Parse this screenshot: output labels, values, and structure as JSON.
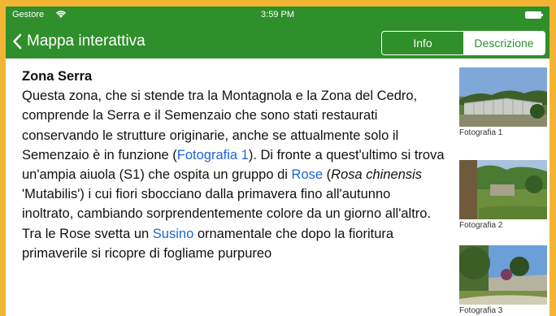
{
  "status_bar": {
    "carrier": "Gestore",
    "time": "3:59 PM",
    "wifi_icon": "wifi-icon",
    "battery_icon": "battery-icon"
  },
  "nav": {
    "back_label": "Mappa interattiva",
    "back_icon": "chevron-left-icon",
    "tabs": [
      {
        "label": "Info",
        "selected": false
      },
      {
        "label": "Descrizione",
        "selected": true
      }
    ]
  },
  "colors": {
    "bar_green": "#2f8f2b",
    "link_blue": "#1a66d6",
    "border_orange": "#f2b533"
  },
  "article": {
    "title": "Zona Serra",
    "p1": "Questa zona, che si stende tra la Montagnola e la Zona del Cedro, comprende la Serra e il Semenzaio che sono stati restaurati conservando le strutture originarie, anche se attualmente solo il Semenzaio è in funzione (",
    "link1": "Fotografia 1",
    "p2": "). Di fronte a quest'ultimo si trova un'ampia aiuola (S1) che ospita un gruppo di ",
    "link2": "Rose",
    "p3": " (",
    "italic1": "Rosa chinensis",
    "p4": " 'Mutabilis') i cui fiori sbocciano dalla primavera fino all'autunno inoltrato, cambiando sorprendentemente colore da un giorno all'altro. Tra le Rose svetta un ",
    "link3": "Susino",
    "p5": " ornamentale che dopo la fioritura primaverile si ricopre di fogliame purpureo"
  },
  "photos": [
    {
      "caption": "Fotografia 1"
    },
    {
      "caption": "Fotografia 2"
    },
    {
      "caption": "Fotografia 3"
    }
  ]
}
